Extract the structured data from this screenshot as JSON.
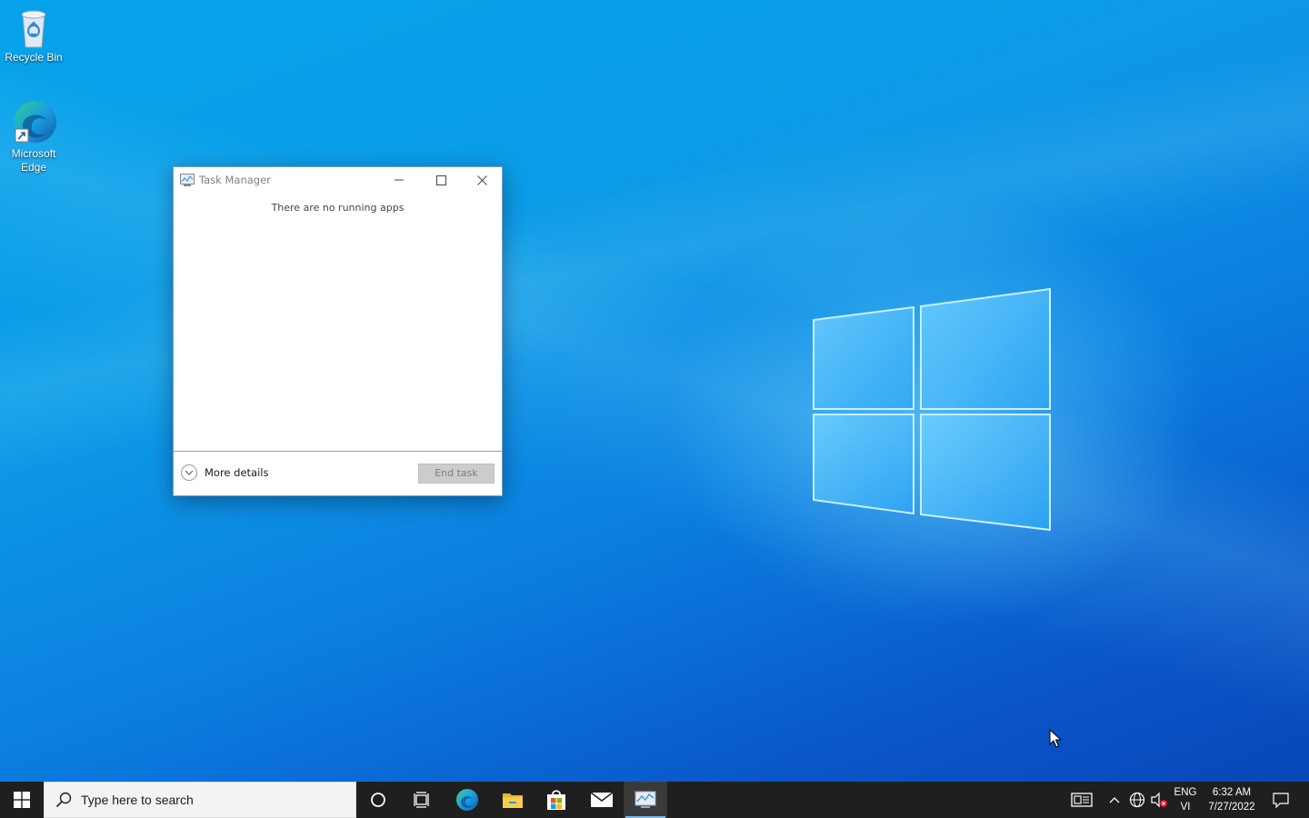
{
  "desktop": {
    "icons": [
      {
        "label": "Recycle Bin",
        "icon": "recycle-bin-icon"
      },
      {
        "label": "Microsoft Edge",
        "icon": "edge-icon"
      }
    ],
    "accent_color": "#0a7fe0"
  },
  "task_manager": {
    "title": "Task Manager",
    "message": "There are no running apps",
    "more_details_label": "More details",
    "end_task_label": "End task",
    "end_task_enabled": false
  },
  "taskbar": {
    "search_placeholder": "Type here to search",
    "pinned": [
      {
        "name": "cortana-icon"
      },
      {
        "name": "task-view-icon"
      },
      {
        "name": "edge-icon"
      },
      {
        "name": "file-explorer-icon"
      },
      {
        "name": "microsoft-store-icon"
      },
      {
        "name": "mail-icon"
      },
      {
        "name": "task-manager-icon",
        "active": true
      }
    ],
    "tray": {
      "language_line1": "ENG",
      "language_line2": "VI",
      "time": "6:32 AM",
      "date": "7/27/2022"
    }
  }
}
